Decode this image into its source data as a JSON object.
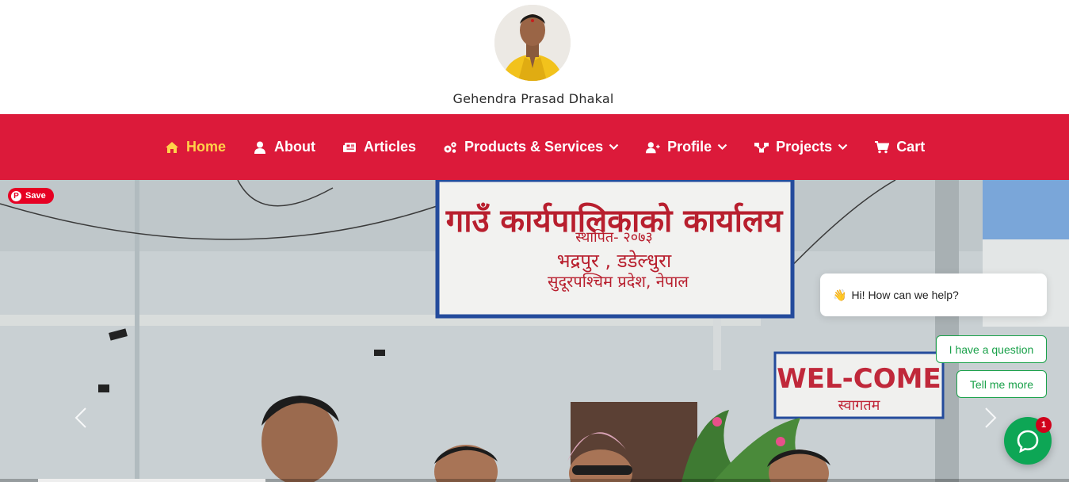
{
  "header": {
    "site_name": "Gehendra Prasad Dhakal",
    "avatar_icon": "profile-photo"
  },
  "nav": {
    "items": [
      {
        "label": "Home",
        "icon": "home-icon",
        "active": true,
        "dropdown": false
      },
      {
        "label": "About",
        "icon": "user-icon",
        "active": false,
        "dropdown": false
      },
      {
        "label": "Articles",
        "icon": "newspaper-icon",
        "active": false,
        "dropdown": false
      },
      {
        "label": "Products & Services",
        "icon": "gears-icon",
        "active": false,
        "dropdown": true
      },
      {
        "label": "Profile",
        "icon": "user-plus-icon",
        "active": false,
        "dropdown": true
      },
      {
        "label": "Projects",
        "icon": "project-diagram-icon",
        "active": false,
        "dropdown": true
      },
      {
        "label": "Cart",
        "icon": "cart-icon",
        "active": false,
        "dropdown": false
      }
    ]
  },
  "hero": {
    "sign_line_1": "गाउँ कार्यपालिकाको कार्यालय",
    "sign_line_2": "स्थापित- २०७३",
    "sign_line_3": "भद्रपुर , डडेल्धुरा",
    "sign_line_4": "सुदूरपश्चिम प्रदेश, नेपाल",
    "welcome_text": "WEL-COME",
    "welcome_sub": "स्वागतम"
  },
  "pinterest": {
    "save_label": "Save"
  },
  "chat": {
    "greeting": "Hi! How can we help?",
    "option_1": "I have a question",
    "option_2": "Tell me more",
    "badge_count": "1"
  },
  "colors": {
    "nav_bg": "#dc1a3a",
    "nav_active": "#ffd24a",
    "chat_green": "#0da655",
    "pinterest_red": "#e60023"
  }
}
